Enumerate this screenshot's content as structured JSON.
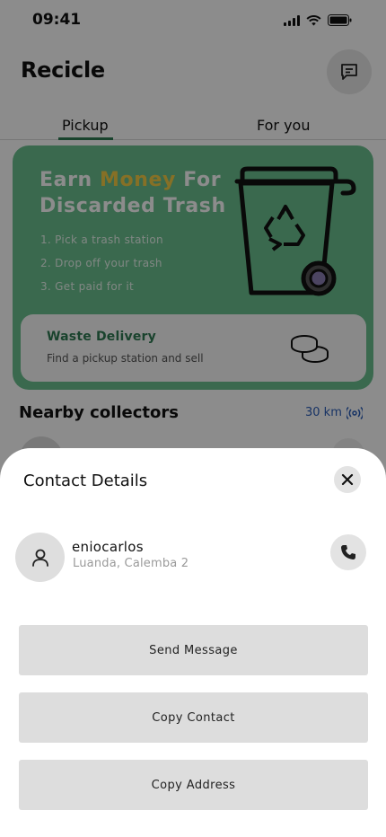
{
  "status": {
    "time": "09:41"
  },
  "header": {
    "title": "Recicle"
  },
  "tabs": [
    {
      "label": "Pickup",
      "active": true
    },
    {
      "label": "For you",
      "active": false
    }
  ],
  "hero": {
    "title_line1_prefix": "Earn ",
    "title_highlight": "Money",
    "title_line1_suffix": " For",
    "title_line2": "Discarded Trash",
    "steps": [
      "1. Pick a trash station",
      "2. Drop off your trash",
      "3. Get paid for it"
    ],
    "delivery": {
      "title": "Waste Delivery",
      "subtitle": "Find a pickup station and sell"
    }
  },
  "nearby": {
    "title": "Nearby collectors",
    "distance": "30 km"
  },
  "sheet": {
    "title": "Contact Details",
    "contact": {
      "name": "eniocarlos",
      "address": "Luanda, Calemba 2"
    },
    "actions": {
      "send": "Send Message",
      "copy_contact": "Copy Contact",
      "copy_address": "Copy Address"
    }
  },
  "colors": {
    "brand_green": "#2f7a53",
    "hero_bg": "#6bbf8f",
    "highlight": "#f5cc45",
    "link_blue": "#2b5db8"
  },
  "icons": {
    "chat": "chat-bubble-icon",
    "bin": "recycle-bin-icon",
    "coins": "coins-icon",
    "radar": "radar-icon",
    "close": "close-icon",
    "user": "user-icon",
    "phone": "phone-icon"
  }
}
